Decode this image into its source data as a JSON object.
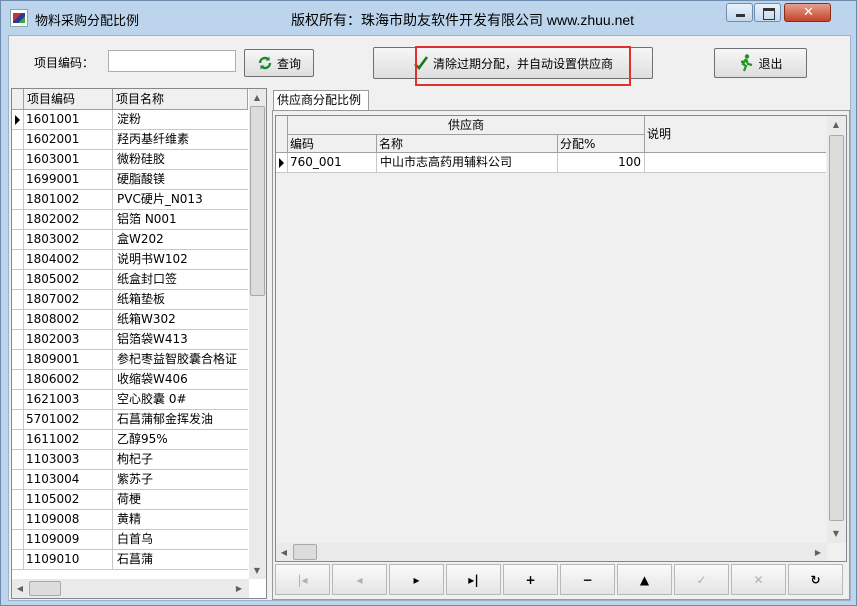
{
  "window": {
    "title": "物料采购分配比例",
    "copyright": "版权所有：珠海市助友软件开发有限公司 www.zhuu.net"
  },
  "toolbar": {
    "code_label": "项目编码：",
    "code_value": "",
    "query_label": "查询",
    "clear_label": "清除过期分配，并自动设置供应商",
    "exit_label": "退出"
  },
  "items": {
    "columns": [
      "项目编码",
      "项目名称"
    ],
    "rows": [
      {
        "code": "1601001",
        "name": "淀粉"
      },
      {
        "code": "1602001",
        "name": "羟丙基纤维素"
      },
      {
        "code": "1603001",
        "name": "微粉硅胶"
      },
      {
        "code": "1699001",
        "name": "硬脂酸镁"
      },
      {
        "code": "1801002",
        "name": "PVC硬片_N013"
      },
      {
        "code": "1802002",
        "name": "铝箔 N001"
      },
      {
        "code": "1803002",
        "name": "盒W202"
      },
      {
        "code": "1804002",
        "name": "说明书W102"
      },
      {
        "code": "1805002",
        "name": "纸盒封口签"
      },
      {
        "code": "1807002",
        "name": "纸箱垫板"
      },
      {
        "code": "1808002",
        "name": "纸箱W302"
      },
      {
        "code": "1802003",
        "name": "铝箔袋W413"
      },
      {
        "code": "1809001",
        "name": "参杞枣益智胶囊合格证"
      },
      {
        "code": "1806002",
        "name": "收缩袋W406"
      },
      {
        "code": "1621003",
        "name": "空心胶囊 0#"
      },
      {
        "code": "5701002",
        "name": "石菖蒲郁金挥发油"
      },
      {
        "code": "1611002",
        "name": "乙醇95%"
      },
      {
        "code": "1103003",
        "name": "枸杞子"
      },
      {
        "code": "1103004",
        "name": "紫苏子"
      },
      {
        "code": "1105002",
        "name": "荷梗"
      },
      {
        "code": "1109008",
        "name": "黄精"
      },
      {
        "code": "1109009",
        "name": "白首乌"
      },
      {
        "code": "1109010",
        "name": "石菖蒲"
      }
    ]
  },
  "tab": {
    "label": "供应商分配比例"
  },
  "supplier_grid": {
    "group_header": "供应商",
    "col_code": "编码",
    "col_name": "名称",
    "col_ratio": "分配%",
    "col_note": "说明",
    "rows": [
      {
        "code": "760_001",
        "name": "中山市志高药用辅料公司",
        "ratio": "100",
        "note": ""
      }
    ]
  },
  "navigator": {
    "buttons": [
      {
        "name": "first",
        "glyph": "|◂",
        "enabled": false
      },
      {
        "name": "prior",
        "glyph": "◂",
        "enabled": false
      },
      {
        "name": "next",
        "glyph": "▸",
        "enabled": true
      },
      {
        "name": "last",
        "glyph": "▸|",
        "enabled": true
      },
      {
        "name": "insert",
        "glyph": "+",
        "enabled": true
      },
      {
        "name": "delete",
        "glyph": "−",
        "enabled": true
      },
      {
        "name": "edit",
        "glyph": "▲",
        "enabled": true
      },
      {
        "name": "post",
        "glyph": "✓",
        "enabled": false
      },
      {
        "name": "cancel",
        "glyph": "✕",
        "enabled": false
      },
      {
        "name": "refresh",
        "glyph": "↻",
        "enabled": true
      }
    ]
  }
}
